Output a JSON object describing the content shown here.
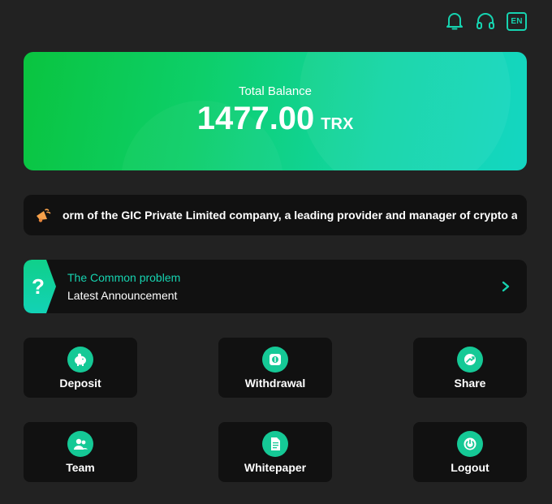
{
  "header": {
    "icons": [
      "bell-icon",
      "headset-icon"
    ],
    "lang": "EN",
    "accent": "#16d3b0"
  },
  "balance": {
    "label": "Total Balance",
    "amount": "1477.00",
    "unit": "TRX",
    "gradient": [
      "#0ac43f",
      "#14d6c2"
    ]
  },
  "marquee": {
    "icon": "megaphone-icon",
    "text": "orm of the GIC Private Limited company, a leading provider and manager of crypto and De"
  },
  "notice": {
    "badge": "?",
    "title": "The Common problem",
    "subtitle": "Latest Announcement"
  },
  "actions": [
    {
      "label": "Deposit",
      "icon": "piggy-bank-icon"
    },
    {
      "label": "Withdrawal",
      "icon": "withdraw-icon"
    },
    {
      "label": "Share",
      "icon": "share-icon"
    },
    {
      "label": "Team",
      "icon": "team-icon"
    },
    {
      "label": "Whitepaper",
      "icon": "document-icon"
    },
    {
      "label": "Logout",
      "icon": "power-icon"
    }
  ]
}
